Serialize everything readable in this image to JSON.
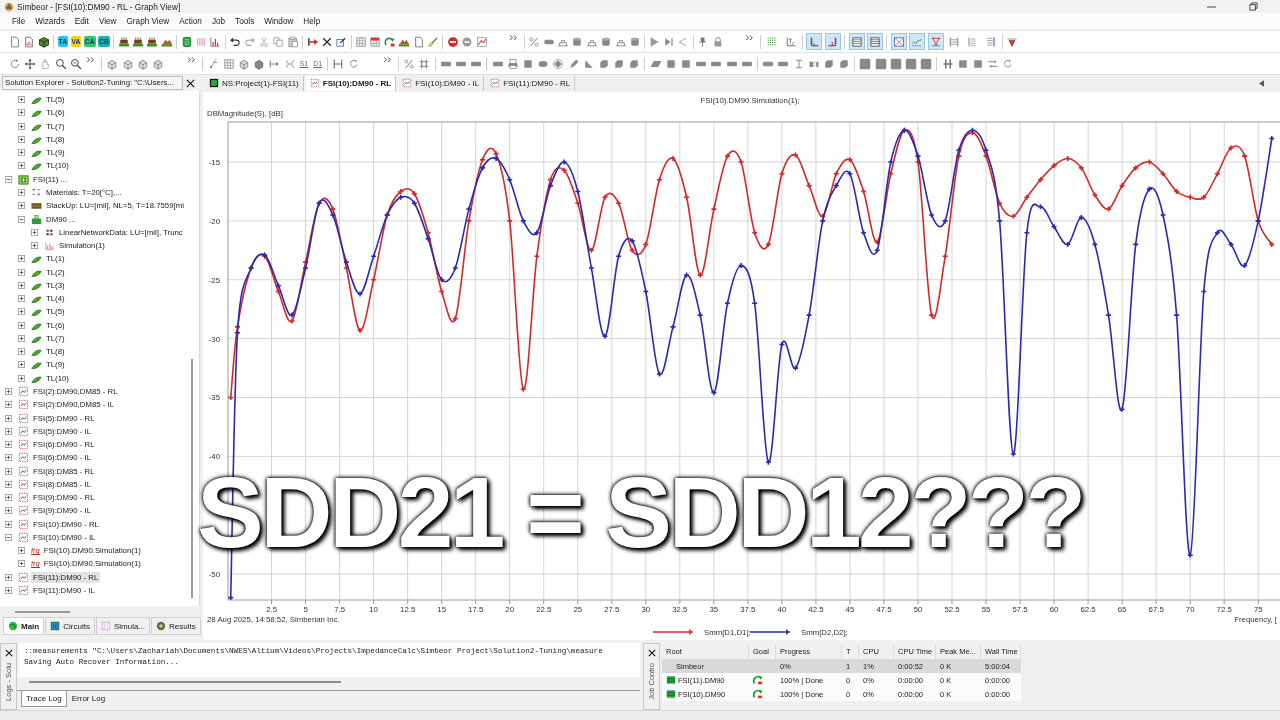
{
  "window": {
    "title": "Simbeor - [FSI(10):DM90 - RL - Graph View]"
  },
  "menu": [
    "File",
    "Wizards",
    "Edit",
    "View",
    "Graph View",
    "Action",
    "Job",
    "Tools",
    "Window",
    "Help"
  ],
  "toolbar_1": {
    "badges": [
      {
        "text": "TA",
        "color": "#22c4e8"
      },
      {
        "text": "VA",
        "color": "#f4d418"
      },
      {
        "text": "CA",
        "color": "#34c46c"
      },
      {
        "text": "CB",
        "color": "#1fb0a4"
      }
    ],
    "toggles": [
      {
        "on": false
      },
      {
        "on": false
      },
      {
        "on": true
      },
      {
        "on": true
      },
      {
        "on": true
      },
      {
        "on": true
      },
      {
        "on": true
      },
      {
        "on": true
      },
      {
        "on": true
      },
      {
        "on": false
      },
      {
        "on": false
      },
      {
        "on": false
      }
    ]
  },
  "toolbar_2": {
    "badges": [
      {
        "text": "S1"
      },
      {
        "text": "D1"
      }
    ]
  },
  "solution_explorer": {
    "title": "Solution Explorer - Solution2-Tuning: \"C:\\Users...",
    "tree": {
      "continued": [
        {
          "label": "TL(5)",
          "kind": "line",
          "expanded": false,
          "selected": false
        },
        {
          "label": "TL(6)",
          "kind": "line",
          "expanded": false,
          "selected": false
        },
        {
          "label": "TL(7)",
          "kind": "line",
          "expanded": false,
          "selected": false
        },
        {
          "label": "TL(8)",
          "kind": "line",
          "expanded": false,
          "selected": false
        },
        {
          "label": "TL(9)",
          "kind": "line",
          "expanded": false,
          "selected": false
        },
        {
          "label": "TL(10)",
          "kind": "line",
          "expanded": false,
          "selected": false
        }
      ],
      "items": [
        {
          "label": "FSI(11) ...",
          "kind": "project",
          "expanded": true,
          "selected": false,
          "children": [
            {
              "label": "Materials: T=20[°C],...",
              "kind": "materials",
              "expanded": false,
              "selected": false
            },
            {
              "label": "StackUp: LU=[mil], NL=5, T=18.7559[mi",
              "kind": "stackup",
              "expanded": false,
              "selected": false
            },
            {
              "label": "DM90 ...",
              "kind": "component",
              "expanded": true,
              "selected": false,
              "children": [
                {
                  "label": "LinearNetworkData: LU=[mil], Trunc",
                  "kind": "network",
                  "expanded": false,
                  "selected": false
                },
                {
                  "label": "Simulation(1)",
                  "kind": "simulation",
                  "expanded": false,
                  "selected": false
                }
              ]
            },
            {
              "label": "TL(1)",
              "kind": "line",
              "expanded": false,
              "selected": false
            },
            {
              "label": "TL(2)",
              "kind": "line",
              "expanded": false,
              "selected": false
            },
            {
              "label": "TL(3)",
              "kind": "line",
              "expanded": false,
              "selected": false
            },
            {
              "label": "TL(4)",
              "kind": "line",
              "expanded": false,
              "selected": false
            },
            {
              "label": "TL(5)",
              "kind": "line",
              "expanded": false,
              "selected": false
            },
            {
              "label": "TL(6)",
              "kind": "line",
              "expanded": false,
              "selected": false
            },
            {
              "label": "TL(7)",
              "kind": "line",
              "expanded": false,
              "selected": false
            },
            {
              "label": "TL(8)",
              "kind": "line",
              "expanded": false,
              "selected": false
            },
            {
              "label": "TL(9)",
              "kind": "line",
              "expanded": false,
              "selected": false
            },
            {
              "label": "TL(10)",
              "kind": "line",
              "expanded": false,
              "selected": false
            }
          ]
        },
        {
          "label": "FSI(2):DM90,DM85 - RL",
          "kind": "graph",
          "expanded": false,
          "selected": false
        },
        {
          "label": "FSI(2):DM90,DM85 - IL",
          "kind": "graph",
          "expanded": false,
          "selected": false
        },
        {
          "label": "FSI(5):DM90 - RL",
          "kind": "graph",
          "expanded": false,
          "selected": false
        },
        {
          "label": "FSI(5):DM90 - IL",
          "kind": "graph",
          "expanded": false,
          "selected": false
        },
        {
          "label": "FSI(6):DM90 - RL",
          "kind": "graph",
          "expanded": false,
          "selected": false
        },
        {
          "label": "FSI(6):DM90 - IL",
          "kind": "graph",
          "expanded": false,
          "selected": false
        },
        {
          "label": "FSI(8):DM85 - RL",
          "kind": "graph",
          "expanded": false,
          "selected": false
        },
        {
          "label": "FSI(8):DM85 - IL",
          "kind": "graph",
          "expanded": false,
          "selected": false
        },
        {
          "label": "FSI(9):DM90 - RL",
          "kind": "graph",
          "expanded": false,
          "selected": false
        },
        {
          "label": "FSI(9):DM90 - IL",
          "kind": "graph",
          "expanded": false,
          "selected": false
        },
        {
          "label": "FSI(10):DM90 - RL",
          "kind": "graph",
          "expanded": false,
          "selected": false
        },
        {
          "label": "FSI(10):DM90 - IL",
          "kind": "graph",
          "expanded": true,
          "selected": false,
          "children": [
            {
              "label": "FSI(10).DM90.Simulation(1)",
              "kind": "frequency",
              "badge": "frg",
              "expanded": false,
              "selected": false
            },
            {
              "label": "FSI(10).DM90.Simulation(1)",
              "kind": "frequency",
              "badge": "frg",
              "expanded": false,
              "selected": false
            }
          ]
        },
        {
          "label": "FSI(11):DM90 - RL",
          "kind": "graph",
          "expanded": false,
          "selected": true
        },
        {
          "label": "FSI(11):DM90 - IL",
          "kind": "graph",
          "expanded": false,
          "selected": false
        }
      ]
    },
    "tabs": [
      {
        "label": "Main",
        "kind": "main",
        "selected": true
      },
      {
        "label": "Circuits",
        "kind": "circuits",
        "selected": false
      },
      {
        "label": "Simula...",
        "kind": "simulations",
        "selected": false
      },
      {
        "label": "Results",
        "kind": "results",
        "selected": false
      }
    ]
  },
  "graph_tabs": [
    {
      "label": "NS:Project(1)-FSI(11)",
      "kind": "project",
      "selected": false
    },
    {
      "label": "FSI(10):DM90 - RL",
      "kind": "graph",
      "selected": true
    },
    {
      "label": "FSI(10):DM90 - IL",
      "kind": "graph",
      "selected": false
    },
    {
      "label": "FSI(11):DM90 - RL",
      "kind": "graph",
      "selected": false
    }
  ],
  "graph": {
    "chart_data": {
      "type": "line",
      "title": "FSI(10).DM90.Simulation(1);",
      "ylabel": "DBMagnitude(S), [dB]",
      "xlabel": "Frequency, [",
      "x": [
        -0.5,
        0,
        1,
        2,
        3,
        4,
        5,
        6,
        7,
        8,
        9,
        10,
        11,
        12,
        13,
        14,
        15,
        16,
        17,
        18,
        19,
        20,
        21,
        22,
        23,
        24,
        25,
        26,
        27,
        28,
        29,
        30,
        31,
        32,
        33,
        34,
        35,
        36,
        37,
        38,
        39,
        40,
        41,
        42,
        43,
        44,
        45,
        46,
        47,
        48,
        49,
        50,
        51,
        52,
        53,
        54,
        55,
        56,
        57,
        58,
        59,
        60,
        61,
        62,
        63,
        64,
        65,
        66,
        67,
        68,
        69,
        70,
        71,
        72,
        73,
        74,
        75,
        76
      ],
      "series": [
        {
          "name": "Smm[D1,D1];",
          "color": "#d42828",
          "marker": "plus",
          "values": [
            -35,
            -29,
            -24,
            -23,
            -26,
            -28.5,
            -23.5,
            -18.5,
            -19,
            -24,
            -29.3,
            -25,
            -19.5,
            -17.5,
            -17.7,
            -21,
            -26,
            -28.3,
            -20,
            -14.8,
            -14.3,
            -20,
            -34.3,
            -23,
            -16.5,
            -15.7,
            -18.5,
            -22.5,
            -18,
            -18.5,
            -22.5,
            -22,
            -16.5,
            -14.7,
            -18,
            -24.6,
            -19,
            -14.5,
            -15,
            -21,
            -22,
            -16,
            -14.4,
            -17,
            -19.6,
            -16,
            -14.8,
            -17.5,
            -21.8,
            -16,
            -12.3,
            -15,
            -28,
            -23,
            -14.5,
            -12.5,
            -14.5,
            -18.5,
            -19.6,
            -18,
            -16.5,
            -15.3,
            -14.7,
            -15.5,
            -17.8,
            -19,
            -17,
            -15.5,
            -15,
            -16,
            -17.5,
            -18,
            -18,
            -16,
            -13.8,
            -14.5,
            -20,
            -22
          ]
        },
        {
          "name": "Smm[D2,D2];",
          "color": "#2a2ab0",
          "marker": "plus",
          "values": [
            -52,
            -29.5,
            -24,
            -22.9,
            -25.5,
            -28,
            -24,
            -18.5,
            -19.5,
            -23.5,
            -26.2,
            -23,
            -19.5,
            -18,
            -18.5,
            -21.5,
            -25,
            -24,
            -19,
            -15.5,
            -14.7,
            -16.5,
            -20,
            -21,
            -17,
            -15,
            -17.5,
            -24,
            -29.8,
            -23,
            -21.7,
            -26,
            -33,
            -29,
            -24.6,
            -28,
            -34.6,
            -27,
            -23.8,
            -27,
            -40.5,
            -30.5,
            -32.5,
            -28,
            -20,
            -17,
            -16,
            -21,
            -22.5,
            -15,
            -12.3,
            -14.5,
            -19.5,
            -20,
            -14,
            -12.3,
            -14,
            -20,
            -39.8,
            -21,
            -18.8,
            -20.5,
            -22,
            -19.7,
            -22,
            -28,
            -36,
            -22,
            -17.3,
            -19.5,
            -28,
            -48.4,
            -26,
            -21,
            -22,
            -23.8,
            -20,
            -13
          ]
        }
      ],
      "xlim": [
        -0.7,
        76.6
      ],
      "ylim": [
        -52.2,
        -11.6
      ],
      "grid": true,
      "legend": "bottom",
      "xticks": [
        2.5,
        5,
        7.5,
        10,
        12.5,
        15,
        17.5,
        20,
        22.5,
        25,
        27.5,
        30,
        32.5,
        35,
        37.5,
        40,
        42.5,
        45,
        47.5,
        50,
        52.5,
        55,
        57.5,
        60,
        62.5,
        65,
        67.5,
        70,
        72.5,
        75
      ],
      "yticks": [
        -15,
        -20,
        -25,
        -30,
        -35,
        -40,
        -50
      ]
    },
    "timestamp": "28 Aug 2025, 14:58:52, Simberian Inc."
  },
  "caption": "SDD21 = SDD12???",
  "log": {
    "title": "Logs - Solu",
    "lines": [
      "::measurements \"C:\\Users\\Zachariah\\Documents\\NWES\\Altium\\Videos\\Projects\\ImpedanceCalc\\Simbeor Project\\Solution2-Tuning\\measure",
      "Saving Auto Recover Information..."
    ],
    "tabs": [
      {
        "label": "Trace Log",
        "selected": true
      },
      {
        "label": "Error Log",
        "selected": false
      }
    ]
  },
  "job_control": {
    "title": "Job Contro",
    "columns": [
      "Root",
      "Goal",
      "Progress",
      "T",
      "CPU",
      "CPU Time",
      "Peak Me...",
      "Wall Time"
    ],
    "rows": [
      {
        "kind": "root",
        "selected": true,
        "root": "Simbeor",
        "progress": "0%",
        "t": "1",
        "cpu": "1%",
        "cpu_time": "0:00:52",
        "peak_memory": "0 K",
        "wall_time": "5:00:04"
      },
      {
        "kind": "job",
        "selected": false,
        "root": "FSI(11).DM90",
        "progress": "100% | Done",
        "t": "0",
        "cpu": "0%",
        "cpu_time": "0:00:00",
        "peak_memory": "0 K",
        "wall_time": "0:00:00"
      },
      {
        "kind": "job",
        "selected": false,
        "root": "FSI(10).DM90",
        "progress": "100% | Done",
        "t": "0",
        "cpu": "0%",
        "cpu_time": "0:00:00",
        "peak_memory": "0 K",
        "wall_time": "0:00:00"
      }
    ]
  }
}
